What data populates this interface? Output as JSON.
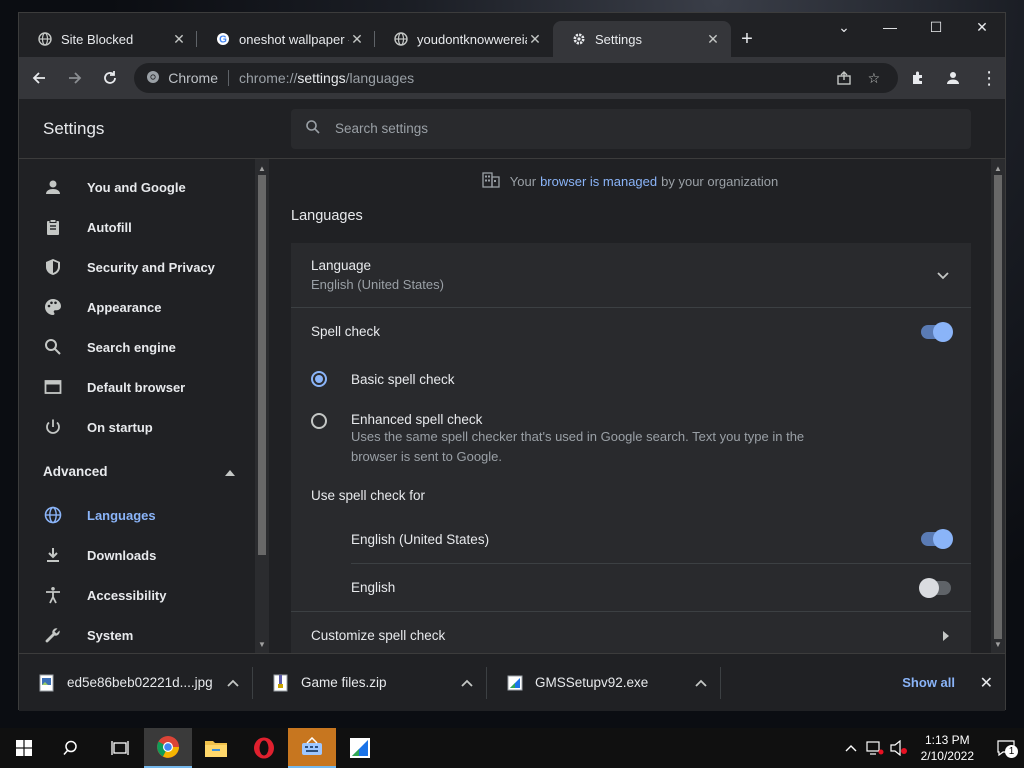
{
  "tabs": [
    {
      "title": "Site Blocked",
      "icon": "globe-icon"
    },
    {
      "title": "oneshot wallpaper - G",
      "icon": "google-icon"
    },
    {
      "title": "youdontknowwereiam",
      "icon": "globe-icon"
    },
    {
      "title": "Settings",
      "icon": "gear-icon",
      "active": true
    }
  ],
  "toolbar": {
    "omnibox_label": "Chrome",
    "url_prefix": "chrome://",
    "url_host": "settings",
    "url_path": "/languages"
  },
  "settings": {
    "title": "Settings",
    "search_placeholder": "Search settings"
  },
  "sidebar": {
    "items": [
      {
        "label": "You and Google",
        "icon": "person-icon"
      },
      {
        "label": "Autofill",
        "icon": "clipboard-icon"
      },
      {
        "label": "Security and Privacy",
        "icon": "shield-icon"
      },
      {
        "label": "Appearance",
        "icon": "palette-icon"
      },
      {
        "label": "Search engine",
        "icon": "search-icon"
      },
      {
        "label": "Default browser",
        "icon": "browser-icon"
      },
      {
        "label": "On startup",
        "icon": "power-icon"
      }
    ],
    "advanced_label": "Advanced",
    "advanced_items": [
      {
        "label": "Languages",
        "icon": "globe-icon",
        "selected": true
      },
      {
        "label": "Downloads",
        "icon": "download-icon"
      },
      {
        "label": "Accessibility",
        "icon": "accessibility-icon"
      },
      {
        "label": "System",
        "icon": "wrench-icon"
      }
    ]
  },
  "main": {
    "managed_before": "Your",
    "managed_link": "browser is managed",
    "managed_after": "by your organization",
    "section_title": "Languages",
    "language_label": "Language",
    "language_value": "English (United States)",
    "spell_check_label": "Spell check",
    "spell_check_on": true,
    "basic_label": "Basic spell check",
    "enhanced_label": "Enhanced spell check",
    "enhanced_desc": "Uses the same spell checker that's used in Google search. Text you type in the browser is sent to Google.",
    "use_for_label": "Use spell check for",
    "spell_langs": [
      {
        "label": "English (United States)",
        "on": true
      },
      {
        "label": "English",
        "on": false
      }
    ],
    "customize_label": "Customize spell check"
  },
  "downloads": {
    "items": [
      {
        "name": "ed5e86beb02221d....jpg",
        "icon": "image-file-icon"
      },
      {
        "name": "Game files.zip",
        "icon": "zip-file-icon"
      },
      {
        "name": "GMSSetupv92.exe",
        "icon": "installer-icon"
      }
    ],
    "show_all": "Show all"
  },
  "taskbar": {
    "time": "1:13 PM",
    "date": "2/10/2022",
    "notification_count": "1"
  },
  "colors": {
    "accent": "#8ab4f8",
    "background": "#202124",
    "card": "#292a2d"
  }
}
